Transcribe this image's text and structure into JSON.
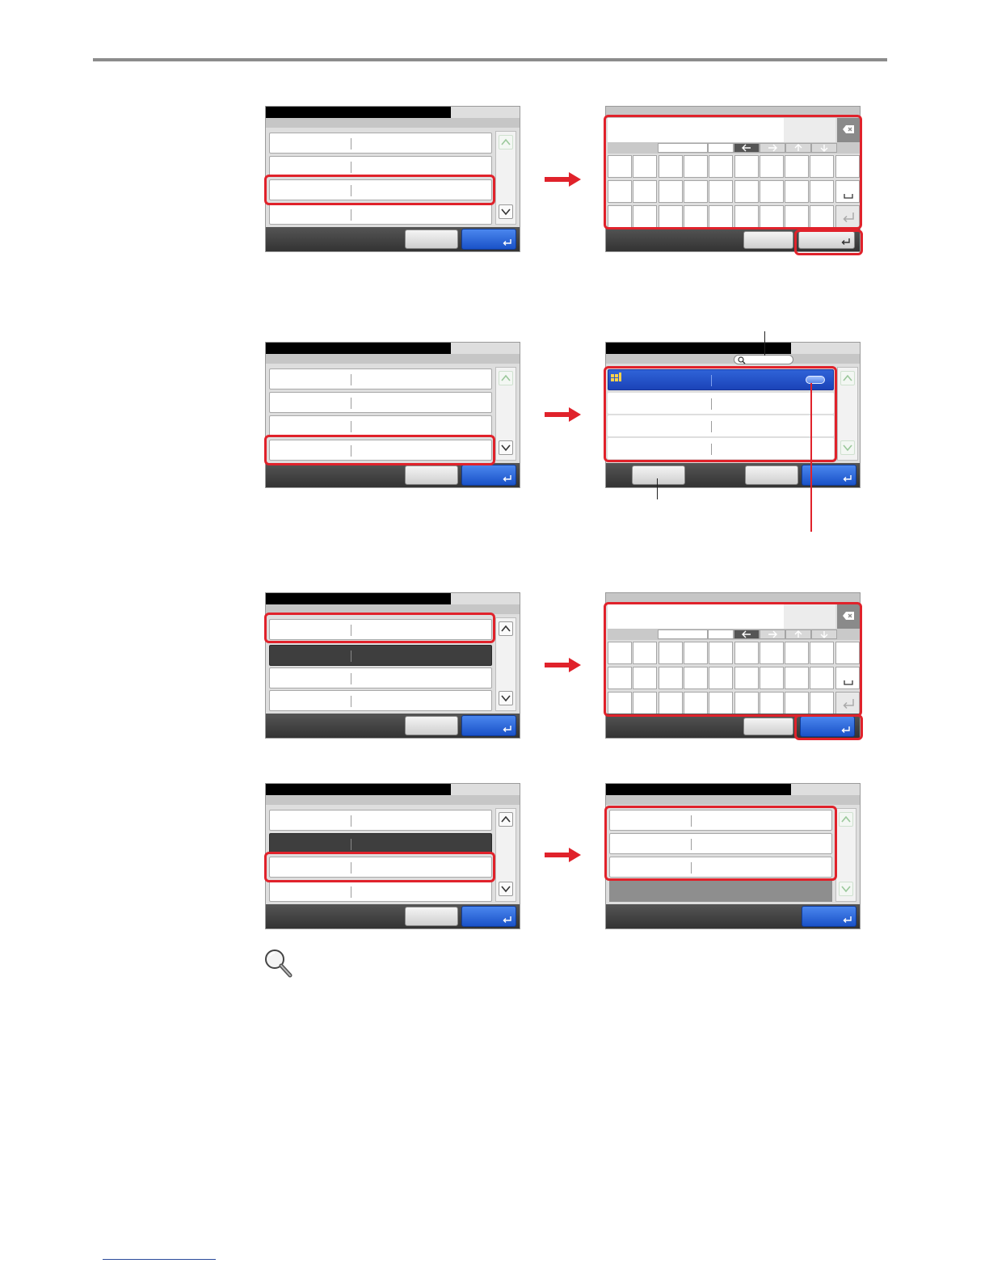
{
  "page": {
    "rule_color": "#8c8c8c",
    "highlight_color": "#e0222b"
  },
  "icons": [
    "scroll-up-icon",
    "scroll-down-icon",
    "enter-icon",
    "backspace-icon",
    "arrow-left-icon",
    "arrow-right-icon",
    "arrow-up-icon",
    "arrow-down-icon",
    "space-icon",
    "search-icon",
    "magnifier-icon",
    "right-arrow-icon",
    "address-book-icon"
  ]
}
